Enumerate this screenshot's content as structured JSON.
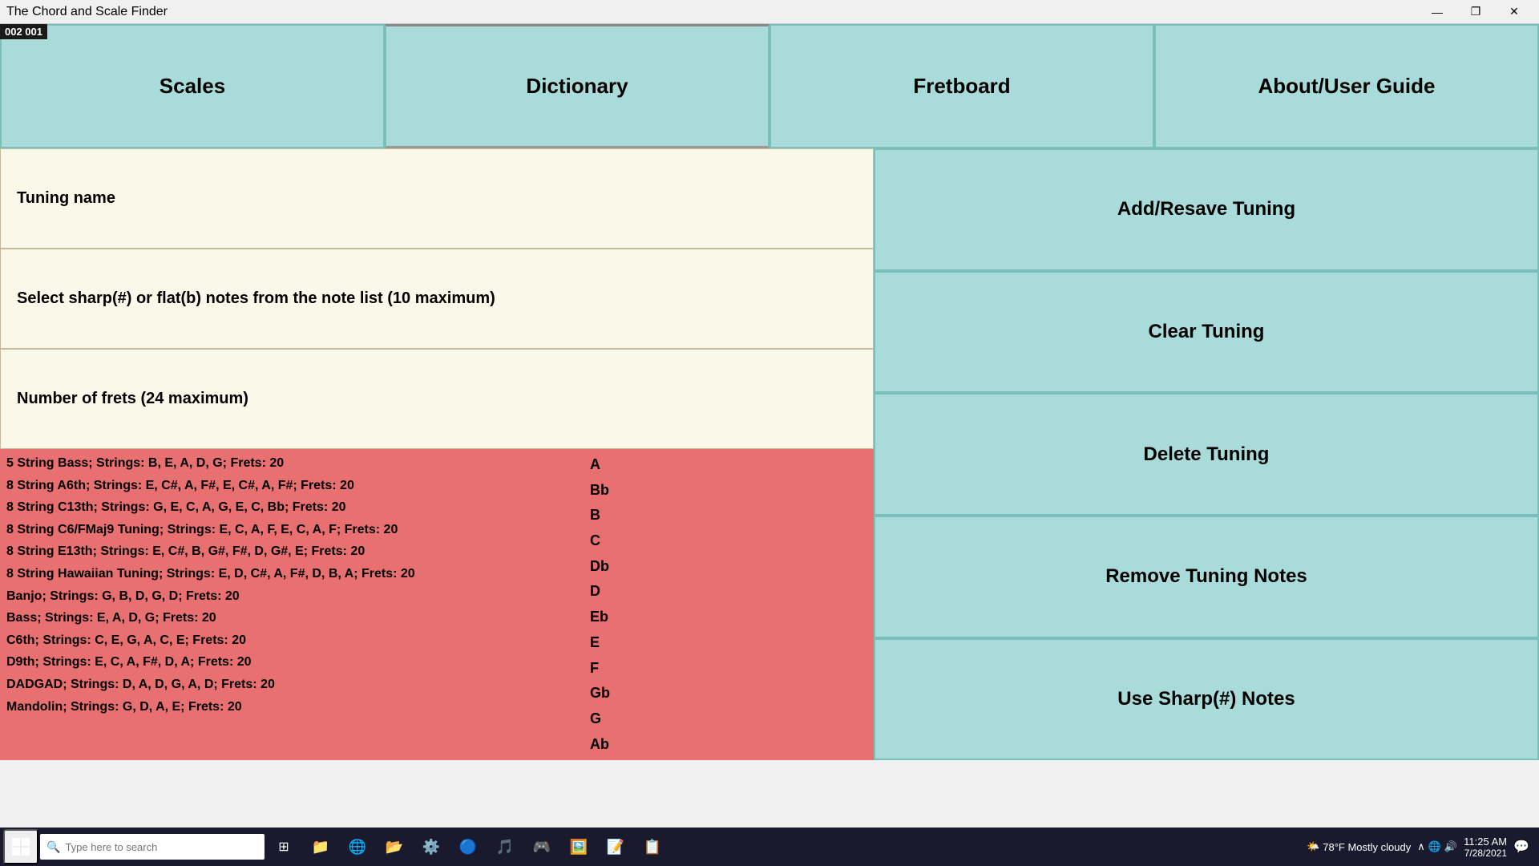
{
  "titlebar": {
    "title": "The Chord and Scale Finder",
    "minimize": "—",
    "maximize": "❐",
    "close": "✕"
  },
  "counter": "002  001",
  "tabs": [
    {
      "label": "Scales",
      "active": false
    },
    {
      "label": "Dictionary",
      "active": true
    },
    {
      "label": "Fretboard",
      "active": false
    },
    {
      "label": "About/User Guide",
      "active": false
    }
  ],
  "tuning_name": {
    "label": "Tuning name"
  },
  "notes_instruction": {
    "text": "Select sharp(#) or flat(b) notes from the note list (10 maximum)"
  },
  "frets": {
    "label": "Number of frets (24 maximum)"
  },
  "right_buttons": [
    {
      "label": "Add/Resave Tuning"
    },
    {
      "label": "Clear Tuning"
    },
    {
      "label": "Delete Tuning"
    },
    {
      "label": "Remove Tuning Notes"
    },
    {
      "label": "Use Sharp(#) Notes"
    }
  ],
  "tunings": [
    "5 String Bass;  Strings: B, E, A, D, G;  Frets: 20",
    "8 String A6th;  Strings: E, C#, A, F#, E, C#, A, F#;  Frets: 20",
    "8 String C13th;  Strings: G, E, C, A, G, E, C, Bb;  Frets: 20",
    "8 String C6/FMaj9 Tuning;  Strings: E, C, A, F, E, C, A, F;  Frets: 20",
    "8 String E13th;  Strings: E, C#, B, G#, F#, D, G#, E;  Frets: 20",
    "8 String Hawaiian Tuning;  Strings: E, D, C#, A, F#, D, B, A;  Frets: 20",
    "Banjo;  Strings: G, B, D, G, D;  Frets: 20",
    "Bass;  Strings: E, A, D, G;  Frets: 20",
    "C6th;  Strings: C, E, G, A, C, E;  Frets: 20",
    "D9th;  Strings: E, C, A, F#, D, A;  Frets: 20",
    "DADGAD;  Strings: D, A, D, G, A, D;  Frets: 20",
    "Mandolin;  Strings: G, D, A, E;  Frets: 20"
  ],
  "notes": [
    "A",
    "Bb",
    "B",
    "C",
    "Db",
    "D",
    "Eb",
    "E",
    "F",
    "Gb",
    "G",
    "Ab"
  ],
  "taskbar": {
    "search_placeholder": "Type here to search",
    "weather": "78°F  Mostly cloudy",
    "time": "11:25 AM",
    "date": "7/28/2021"
  }
}
